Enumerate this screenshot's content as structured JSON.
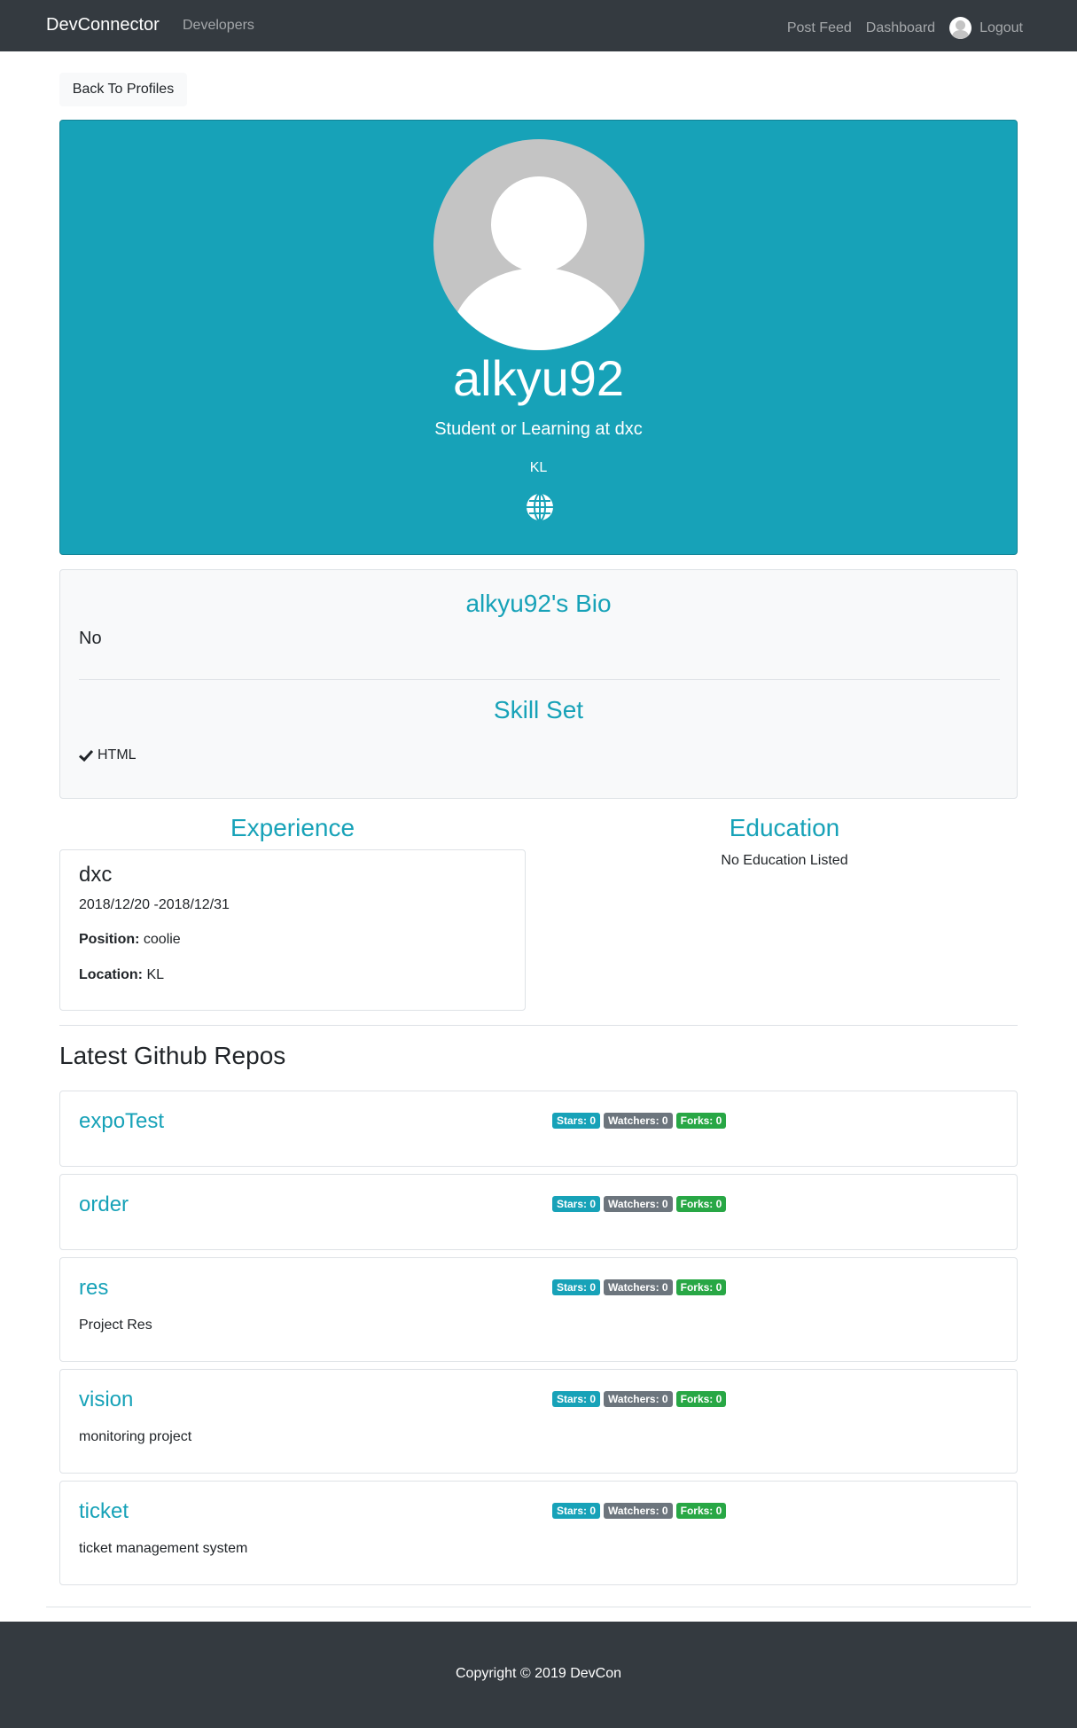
{
  "navbar": {
    "brand": "DevConnector",
    "developers": "Developers",
    "post_feed": "Post Feed",
    "dashboard": "Dashboard",
    "logout": "Logout"
  },
  "back_button": "Back To Profiles",
  "profile": {
    "handle": "alkyu92",
    "status": "Student or Learning at dxc",
    "location": "KL",
    "accent_color": "#17a2b8"
  },
  "bio": {
    "title": "alkyu92's Bio",
    "text": "No"
  },
  "skills": {
    "title": "Skill Set",
    "items": [
      "HTML"
    ]
  },
  "experience": {
    "title": "Experience",
    "items": [
      {
        "company": "dxc",
        "dates": "2018/12/20 -2018/12/31",
        "position_label": "Position:",
        "position": "coolie",
        "location_label": "Location:",
        "location": "KL"
      }
    ]
  },
  "education": {
    "title": "Education",
    "empty": "No Education Listed"
  },
  "repos": {
    "title": "Latest Github Repos",
    "items": [
      {
        "name": "expoTest",
        "description": "",
        "stars": "Stars: 0",
        "watchers": "Watchers: 0",
        "forks": "Forks: 0"
      },
      {
        "name": "order",
        "description": "",
        "stars": "Stars: 0",
        "watchers": "Watchers: 0",
        "forks": "Forks: 0"
      },
      {
        "name": "res",
        "description": "Project Res",
        "stars": "Stars: 0",
        "watchers": "Watchers: 0",
        "forks": "Forks: 0"
      },
      {
        "name": "vision",
        "description": "monitoring project",
        "stars": "Stars: 0",
        "watchers": "Watchers: 0",
        "forks": "Forks: 0"
      },
      {
        "name": "ticket",
        "description": "ticket management system",
        "stars": "Stars: 0",
        "watchers": "Watchers: 0",
        "forks": "Forks: 0"
      }
    ]
  },
  "footer": {
    "copyright": "Copyright © 2019 DevCon"
  }
}
